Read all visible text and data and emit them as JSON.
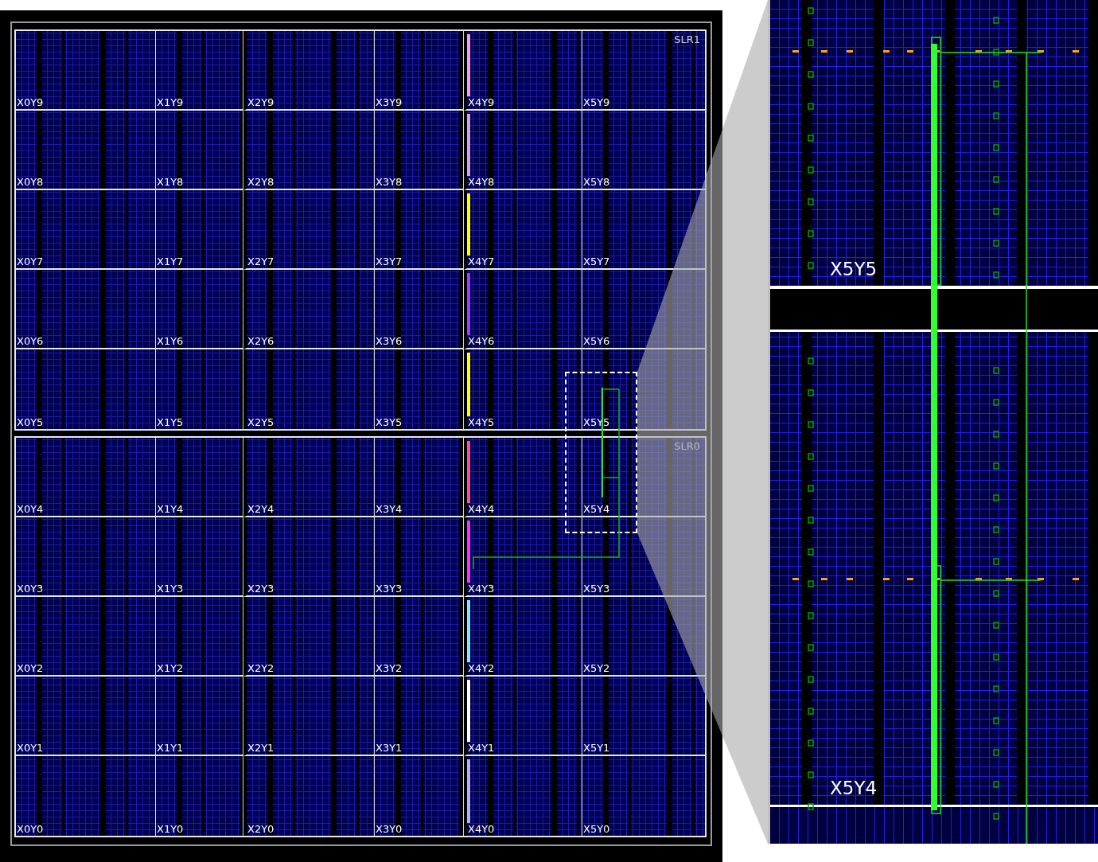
{
  "device_view": {
    "slrs": [
      {
        "label": "SLR1",
        "rows": [
          {
            "regions": [
              "X0Y9",
              "X1Y9",
              "X2Y9",
              "X3Y9",
              "X4Y9",
              "X5Y9"
            ],
            "color": "#ff9be0"
          },
          {
            "regions": [
              "X0Y8",
              "X1Y8",
              "X2Y8",
              "X3Y8",
              "X4Y8",
              "X5Y8"
            ],
            "color": "#d8a0e0"
          },
          {
            "regions": [
              "X0Y7",
              "X1Y7",
              "X2Y7",
              "X3Y7",
              "X4Y7",
              "X5Y7"
            ],
            "color": "#ffff00"
          },
          {
            "regions": [
              "X0Y6",
              "X1Y6",
              "X2Y6",
              "X3Y6",
              "X4Y6",
              "X5Y6"
            ],
            "color": "#9a40ff"
          },
          {
            "regions": [
              "X0Y5",
              "X1Y5",
              "X2Y5",
              "X3Y5",
              "X4Y5",
              "X5Y5"
            ],
            "color": "#ffff00"
          }
        ]
      },
      {
        "label": "SLR0",
        "rows": [
          {
            "regions": [
              "X0Y4",
              "X1Y4",
              "X2Y4",
              "X3Y4",
              "X4Y4",
              "X5Y4"
            ],
            "color": "#ff4f8f"
          },
          {
            "regions": [
              "X0Y3",
              "X1Y3",
              "X2Y3",
              "X3Y3",
              "X4Y3",
              "X5Y3"
            ],
            "color": "#ff30ff"
          },
          {
            "regions": [
              "X0Y2",
              "X1Y2",
              "X2Y2",
              "X3Y2",
              "X4Y2",
              "X5Y2"
            ],
            "color": "#80e8ff"
          },
          {
            "regions": [
              "X0Y1",
              "X1Y1",
              "X2Y1",
              "X3Y1",
              "X4Y1",
              "X5Y1"
            ],
            "color": "#ffffff"
          },
          {
            "regions": [
              "X0Y0",
              "X1Y0",
              "X2Y0",
              "X3Y0",
              "X4Y0",
              "X5Y0"
            ],
            "color": "#b0b0ff"
          }
        ]
      }
    ]
  },
  "zoom_panel": {
    "regions": [
      "X5Y5",
      "X5Y4"
    ]
  }
}
